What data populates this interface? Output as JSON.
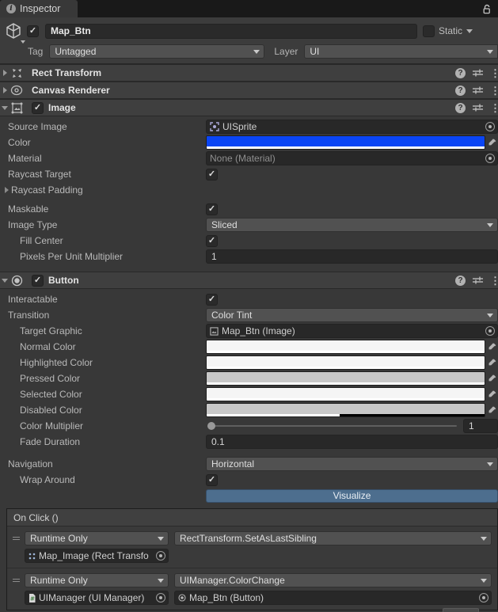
{
  "tab": {
    "title": "Inspector"
  },
  "header": {
    "active_checked": true,
    "name": "Map_Btn",
    "static_label": "Static",
    "tag_label": "Tag",
    "tag_value": "Untagged",
    "layer_label": "Layer",
    "layer_value": "UI"
  },
  "components": {
    "rect_transform": {
      "title": "Rect Transform"
    },
    "canvas_renderer": {
      "title": "Canvas Renderer"
    },
    "image": {
      "title": "Image",
      "enabled": true,
      "source_image": {
        "label": "Source Image",
        "value": "UISprite"
      },
      "color": {
        "label": "Color",
        "hex": "#0a45f5",
        "alpha": 1,
        "alpha_pct": "100%"
      },
      "material": {
        "label": "Material",
        "value": "None (Material)"
      },
      "raycast_target": {
        "label": "Raycast Target",
        "checked": true
      },
      "raycast_padding": {
        "label": "Raycast Padding"
      },
      "maskable": {
        "label": "Maskable",
        "checked": true
      },
      "image_type": {
        "label": "Image Type",
        "value": "Sliced"
      },
      "fill_center": {
        "label": "Fill Center",
        "checked": true
      },
      "pixels_per_unit_multiplier": {
        "label": "Pixels Per Unit Multiplier",
        "value": "1"
      }
    },
    "button": {
      "title": "Button",
      "enabled": true,
      "interactable": {
        "label": "Interactable",
        "checked": true
      },
      "transition": {
        "label": "Transition",
        "value": "Color Tint"
      },
      "target_graphic": {
        "label": "Target Graphic",
        "value": "Map_Btn (Image)"
      },
      "normal_color": {
        "label": "Normal Color",
        "hex": "#f5f5f5",
        "alpha": 1,
        "alpha_pct": "100%"
      },
      "highlighted_color": {
        "label": "Highlighted Color",
        "hex": "#f5f5f5",
        "alpha": 1,
        "alpha_pct": "100%"
      },
      "pressed_color": {
        "label": "Pressed Color",
        "hex": "#c8c8c8",
        "alpha": 1,
        "alpha_pct": "100%"
      },
      "selected_color": {
        "label": "Selected Color",
        "hex": "#f5f5f5",
        "alpha": 1,
        "alpha_pct": "100%"
      },
      "disabled_color": {
        "label": "Disabled Color",
        "hex": "#c8c8c8",
        "alpha": 0.5,
        "alpha_pct": "48%"
      },
      "color_multiplier": {
        "label": "Color Multiplier",
        "value": "1"
      },
      "fade_duration": {
        "label": "Fade Duration",
        "value": "0.1"
      },
      "navigation": {
        "label": "Navigation",
        "value": "Horizontal"
      },
      "wrap_around": {
        "label": "Wrap Around",
        "checked": true
      },
      "visualize_label": "Visualize"
    }
  },
  "on_click": {
    "title": "On Click ()",
    "entries": [
      {
        "mode": "Runtime Only",
        "function": "RectTransform.SetAsLastSibling",
        "target": "Map_Image (Rect Transfo"
      },
      {
        "mode": "Runtime Only",
        "function": "UIManager.ColorChange",
        "target": "UIManager (UI Manager)",
        "argument": "Map_Btn (Button)"
      }
    ]
  }
}
